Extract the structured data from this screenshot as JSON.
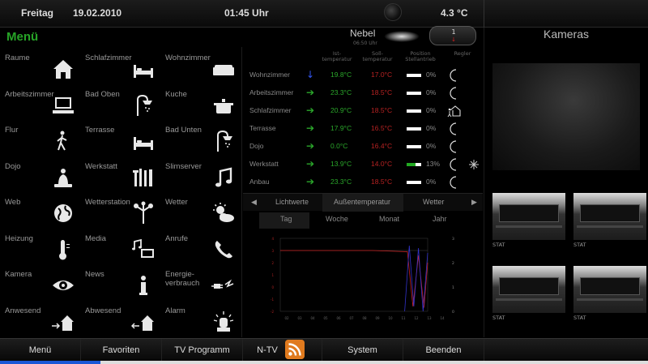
{
  "header": {
    "weekday": "Freitag",
    "date": "19.02.2010",
    "time": "01:45  Uhr",
    "temperature": "4.3 °C"
  },
  "menu": {
    "title": "Menü",
    "items": [
      {
        "label": "Raume",
        "icon": "house-icon"
      },
      {
        "label": "Schlafzimmer",
        "icon": "bed-icon"
      },
      {
        "label": "Wohnzimmer",
        "icon": "sofa-icon"
      },
      {
        "label": "Arbeitszimmer",
        "icon": "computer-icon"
      },
      {
        "label": "Bad Oben",
        "icon": "shower-icon"
      },
      {
        "label": "Kuche",
        "icon": "pot-icon"
      },
      {
        "label": "Flur",
        "icon": "walker-icon"
      },
      {
        "label": "Terrasse",
        "icon": "bed-icon"
      },
      {
        "label": "Bad Unten",
        "icon": "shower-icon"
      },
      {
        "label": "Dojo",
        "icon": "buddha-icon"
      },
      {
        "label": "Werkstatt",
        "icon": "tools-icon"
      },
      {
        "label": "Slimserver",
        "icon": "music-note-icon"
      },
      {
        "label": "Web",
        "icon": "globe-icon"
      },
      {
        "label": "Wetterstation",
        "icon": "anemometer-icon"
      },
      {
        "label": "Wetter",
        "icon": "sun-cloud-icon"
      },
      {
        "label": "Heizung",
        "icon": "thermometer-icon"
      },
      {
        "label": "Media",
        "icon": "media-icon"
      },
      {
        "label": "Anrufe",
        "icon": "phone-icon"
      },
      {
        "label": "Kamera",
        "icon": "eye-icon"
      },
      {
        "label": "News",
        "icon": "info-icon"
      },
      {
        "label": "Energie-verbrauch",
        "icon": "plug-icon"
      },
      {
        "label": "Anwesend",
        "icon": "house-enter-icon"
      },
      {
        "label": "Abwesend",
        "icon": "house-leave-icon"
      },
      {
        "label": "Alarm",
        "icon": "alarm-light-icon"
      }
    ]
  },
  "weather": {
    "condition": "Nebel",
    "condition_time": "06:50 Uhr",
    "counter_value": "1",
    "counter_arrow": "↓"
  },
  "rooms": {
    "headers": {
      "ist": "Ist-\ntemperatur",
      "soll": "Soll-\ntemperatur",
      "position": "Position\nStellantrieb",
      "regler": "Regler"
    },
    "rows": [
      {
        "name": "Wohnzimmer",
        "trend": "down",
        "ist": "19.8°C",
        "soll": "17.0°C",
        "valve": 0,
        "pct": "0%",
        "mode": "night"
      },
      {
        "name": "Arbeitszimmer",
        "trend": "right",
        "ist": "23.3°C",
        "soll": "18.5°C",
        "valve": 0,
        "pct": "0%",
        "mode": "night"
      },
      {
        "name": "Schlafzimmer",
        "trend": "right",
        "ist": "20.9°C",
        "soll": "18.5°C",
        "valve": 0,
        "pct": "0%",
        "mode": "away"
      },
      {
        "name": "Terrasse",
        "trend": "right",
        "ist": "17.9°C",
        "soll": "16.5°C",
        "valve": 0,
        "pct": "0%",
        "mode": "night"
      },
      {
        "name": "Dojo",
        "trend": "right",
        "ist": "0.0°C",
        "soll": "16.4°C",
        "valve": 0,
        "pct": "0%",
        "mode": "night"
      },
      {
        "name": "Werkstatt",
        "trend": "right",
        "ist": "13.9°C",
        "soll": "14.0°C",
        "valve": 13,
        "pct": "13%",
        "mode": "night-frost"
      },
      {
        "name": "Anbau",
        "trend": "right",
        "ist": "23.3°C",
        "soll": "18.5°C",
        "valve": 0,
        "pct": "0%",
        "mode": "night"
      }
    ]
  },
  "chart_tabs": {
    "prev": "◀",
    "next": "▶",
    "items": [
      "Lichtwerte",
      "Außentemperatur",
      "Wetter"
    ]
  },
  "period_tabs": [
    "Tag",
    "Woche",
    "Monat",
    "Jahr"
  ],
  "chart_data": {
    "type": "line",
    "y_left_ticks": [
      "4",
      "3",
      "2",
      "1",
      "0",
      "-1",
      "-2"
    ],
    "y_right_ticks": [
      "3",
      "2",
      "1",
      "0"
    ],
    "x_ticks": [
      "02",
      "03",
      "04",
      "05",
      "06",
      "07",
      "08",
      "09",
      "10",
      "11",
      "12",
      "13",
      "14"
    ],
    "series": [
      {
        "color": "#c22",
        "x": [
          0,
          10,
          13.8,
          14.4,
          15.0,
          15.6,
          16
        ],
        "values": [
          3.0,
          3.0,
          2.9,
          -1.6,
          2.6,
          -1.7,
          2.0
        ]
      },
      {
        "color": "#33c",
        "x": [
          13.5,
          14.0,
          14.5,
          15.0,
          15.5,
          16
        ],
        "values": [
          0,
          2.7,
          0.2,
          2.6,
          0,
          2.4
        ]
      }
    ],
    "ylim_left": [
      -2,
      4
    ],
    "ylim_right": [
      0,
      3
    ],
    "xlim": [
      0,
      16
    ]
  },
  "cameras": {
    "title": "Kameras",
    "thumbs": [
      "STAT",
      "STAT",
      "STAT",
      "STAT"
    ]
  },
  "bottom": {
    "items": [
      "Menü",
      "Favoriten",
      "TV Programm",
      "N-TV",
      "System",
      "Beenden"
    ]
  },
  "progress": {
    "fraction": 0.155
  },
  "colors": {
    "accent_green": "#27a427",
    "soll_red": "#b82222",
    "ist_green": "#2ba82b"
  }
}
